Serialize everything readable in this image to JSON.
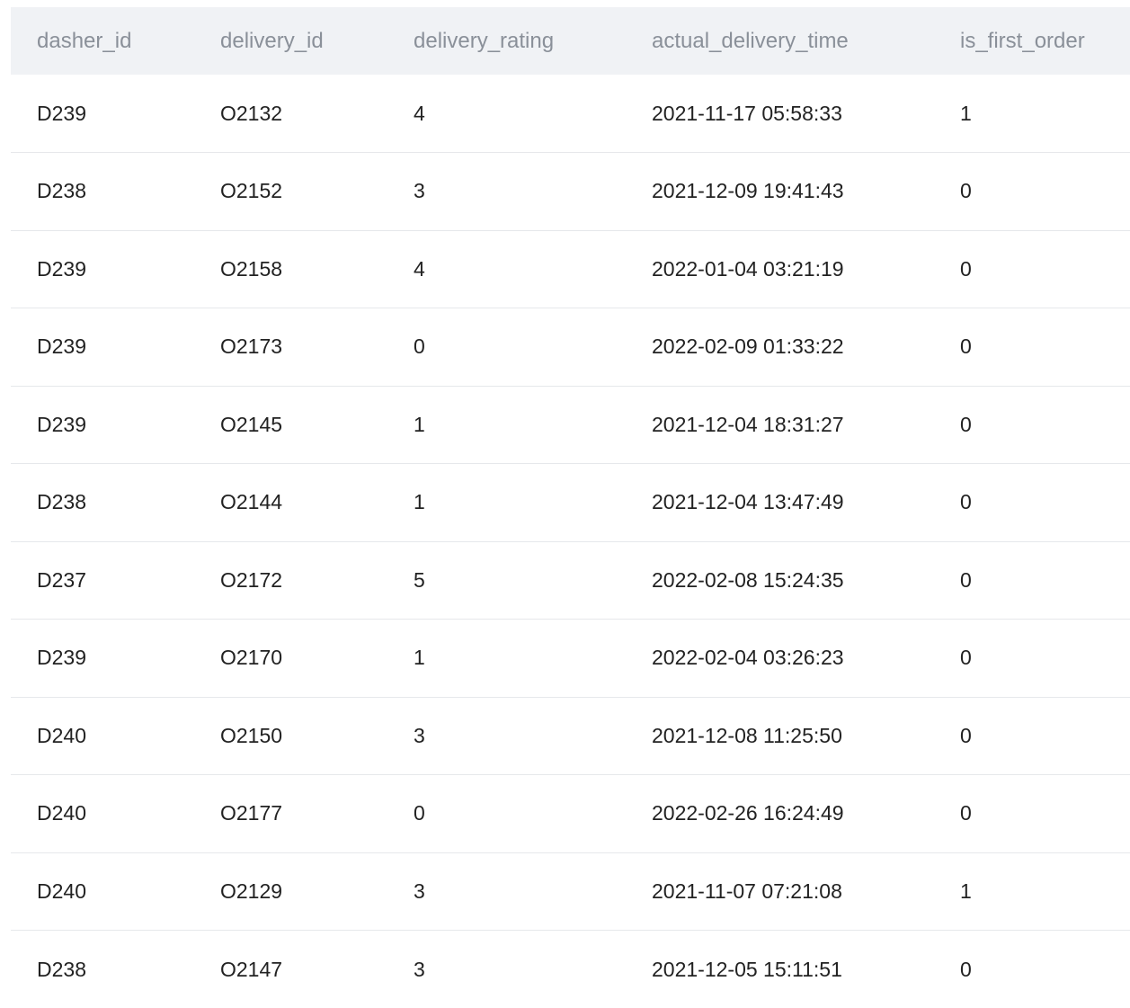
{
  "table": {
    "columns": [
      "dasher_id",
      "delivery_id",
      "delivery_rating",
      "actual_delivery_time",
      "is_first_order"
    ],
    "rows": [
      [
        "D239",
        "O2132",
        "4",
        "2021-11-17 05:58:33",
        "1"
      ],
      [
        "D238",
        "O2152",
        "3",
        "2021-12-09 19:41:43",
        "0"
      ],
      [
        "D239",
        "O2158",
        "4",
        "2022-01-04 03:21:19",
        "0"
      ],
      [
        "D239",
        "O2173",
        "0",
        "2022-02-09 01:33:22",
        "0"
      ],
      [
        "D239",
        "O2145",
        "1",
        "2021-12-04 18:31:27",
        "0"
      ],
      [
        "D238",
        "O2144",
        "1",
        "2021-12-04 13:47:49",
        "0"
      ],
      [
        "D237",
        "O2172",
        "5",
        "2022-02-08 15:24:35",
        "0"
      ],
      [
        "D239",
        "O2170",
        "1",
        "2022-02-04 03:26:23",
        "0"
      ],
      [
        "D240",
        "O2150",
        "3",
        "2021-12-08 11:25:50",
        "0"
      ],
      [
        "D240",
        "O2177",
        "0",
        "2022-02-26 16:24:49",
        "0"
      ],
      [
        "D240",
        "O2129",
        "3",
        "2021-11-07 07:21:08",
        "1"
      ],
      [
        "D238",
        "O2147",
        "3",
        "2021-12-05 15:11:51",
        "0"
      ]
    ]
  },
  "colors": {
    "header_bg": "#f0f2f5",
    "header_text": "#8a9099",
    "row_border": "#e6e8eb",
    "cell_text": "#222222"
  }
}
